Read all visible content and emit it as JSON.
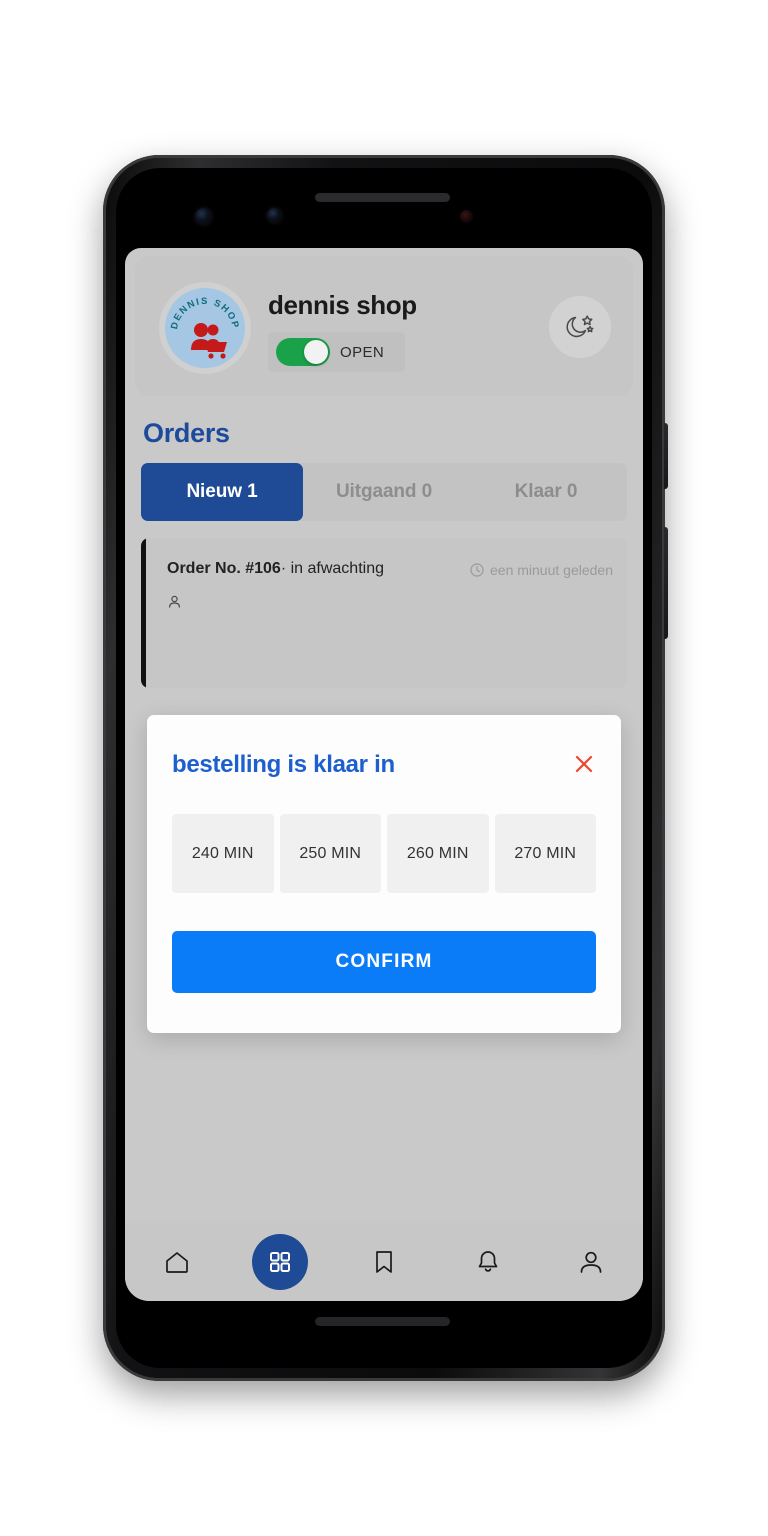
{
  "shop": {
    "name": "dennis shop",
    "logo_text": "DENNIS SHOP",
    "status_label": "OPEN",
    "status_on": true,
    "moon_icon": "moon-stars-icon"
  },
  "orders": {
    "heading": "Orders",
    "tabs": [
      {
        "label": "Nieuw 1",
        "active": true
      },
      {
        "label": "Uitgaand 0",
        "active": false
      },
      {
        "label": "Klaar 0",
        "active": false
      }
    ],
    "card": {
      "number_label": "Order No. #106",
      "separator": "·",
      "status": "in afwachting",
      "time_icon": "clock-icon",
      "time_text": "een minuut geleden"
    }
  },
  "modal": {
    "title": "bestelling is klaar in",
    "close_icon": "close-icon",
    "options": [
      "240 MIN",
      "250 MIN",
      "260 MIN",
      "270 MIN"
    ],
    "confirm_label": "CONFIRM"
  },
  "bottom_nav": [
    {
      "icon": "home-icon",
      "active": false
    },
    {
      "icon": "grid-icon",
      "active": true
    },
    {
      "icon": "bookmark-icon",
      "active": false
    },
    {
      "icon": "bell-icon",
      "active": false
    },
    {
      "icon": "person-icon",
      "active": false
    }
  ],
  "colors": {
    "brand_blue": "#1f4a96",
    "link_blue": "#1e5fd0",
    "confirm_blue": "#0a7cf8",
    "toggle_green": "#1aa24a",
    "close_red": "#f0452d",
    "screen_bg": "#c9c9c9"
  }
}
